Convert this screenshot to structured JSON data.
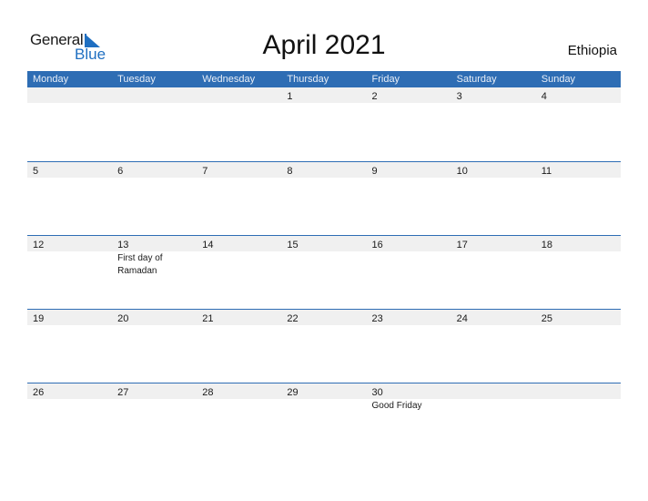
{
  "logo": {
    "line1": "General",
    "line2": "Blue",
    "accent": "#1f6fc1"
  },
  "title": "April 2021",
  "country": "Ethiopia",
  "colors": {
    "header_bg": "#2e6db4",
    "row_strip": "#f0f0f0"
  },
  "weekdays": [
    "Monday",
    "Tuesday",
    "Wednesday",
    "Thursday",
    "Friday",
    "Saturday",
    "Sunday"
  ],
  "weeks": [
    {
      "days": [
        {
          "n": ""
        },
        {
          "n": ""
        },
        {
          "n": ""
        },
        {
          "n": "1"
        },
        {
          "n": "2"
        },
        {
          "n": "3"
        },
        {
          "n": "4"
        }
      ]
    },
    {
      "days": [
        {
          "n": "5"
        },
        {
          "n": "6"
        },
        {
          "n": "7"
        },
        {
          "n": "8"
        },
        {
          "n": "9"
        },
        {
          "n": "10"
        },
        {
          "n": "11"
        }
      ]
    },
    {
      "days": [
        {
          "n": "12"
        },
        {
          "n": "13",
          "event": "First day of Ramadan"
        },
        {
          "n": "14"
        },
        {
          "n": "15"
        },
        {
          "n": "16"
        },
        {
          "n": "17"
        },
        {
          "n": "18"
        }
      ]
    },
    {
      "days": [
        {
          "n": "19"
        },
        {
          "n": "20"
        },
        {
          "n": "21"
        },
        {
          "n": "22"
        },
        {
          "n": "23"
        },
        {
          "n": "24"
        },
        {
          "n": "25"
        }
      ]
    },
    {
      "days": [
        {
          "n": "26"
        },
        {
          "n": "27"
        },
        {
          "n": "28"
        },
        {
          "n": "29"
        },
        {
          "n": "30",
          "event": "Good Friday"
        },
        {
          "n": ""
        },
        {
          "n": ""
        }
      ]
    }
  ]
}
